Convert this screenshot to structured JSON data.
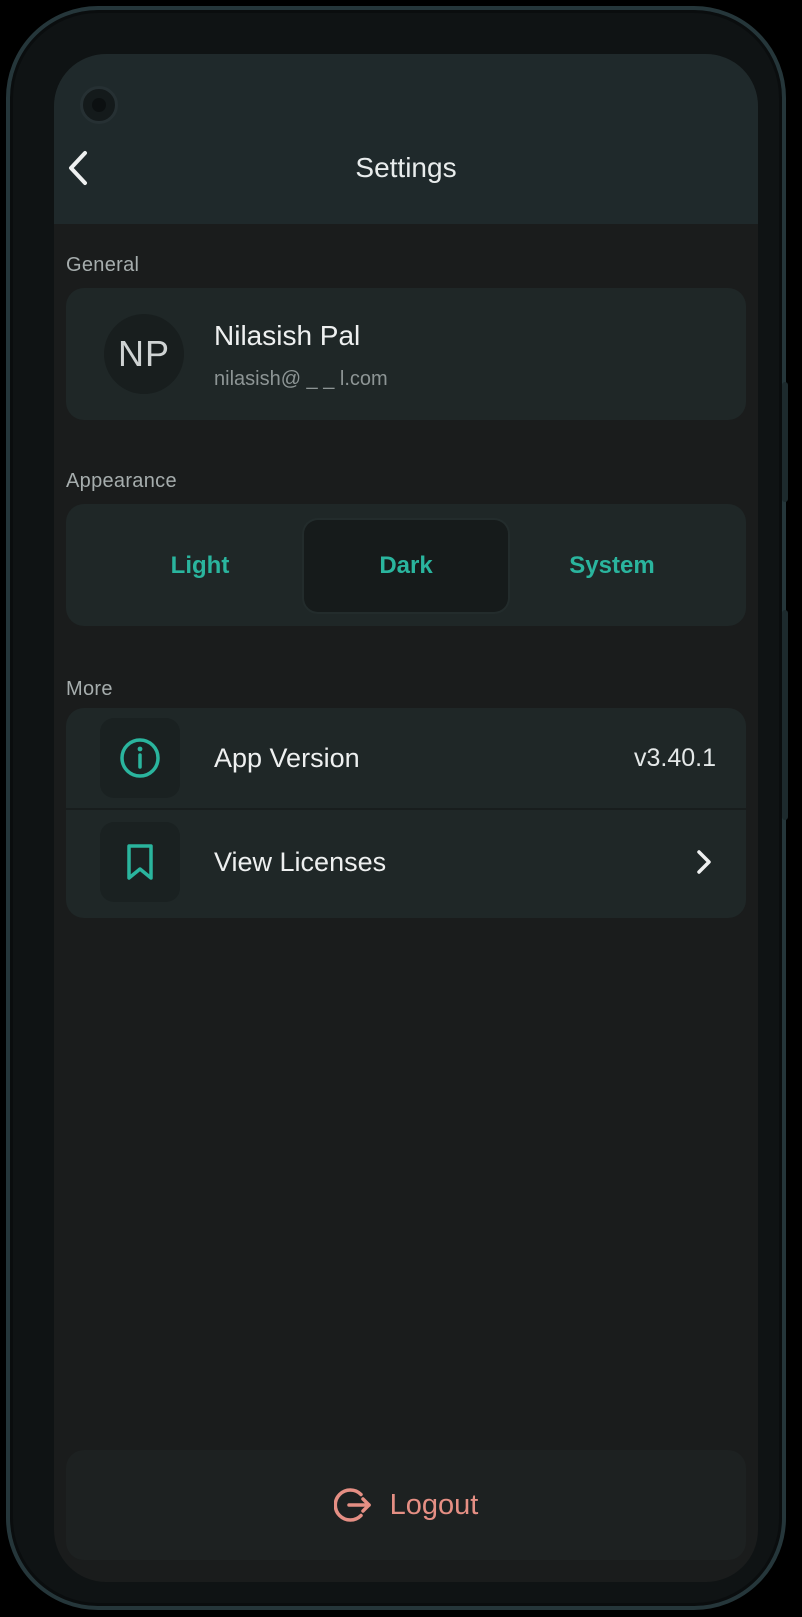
{
  "header": {
    "title": "Settings",
    "back_icon": "chevron-left-icon"
  },
  "general": {
    "section_label": "General",
    "avatar_initials": "NP",
    "user_name": "Nilasish Pal",
    "user_email": "nilasish@ _ _ l.com"
  },
  "appearance": {
    "section_label": "Appearance",
    "options": [
      {
        "label": "Light",
        "selected": false
      },
      {
        "label": "Dark",
        "selected": true
      },
      {
        "label": "System",
        "selected": false
      }
    ]
  },
  "more": {
    "section_label": "More",
    "items": [
      {
        "icon": "info-icon",
        "label": "App Version",
        "value": "v3.40.1"
      },
      {
        "icon": "bookmark-icon",
        "label": "View Licenses",
        "trailing_icon": "chevron-right-icon"
      }
    ]
  },
  "footer": {
    "logout_label": "Logout",
    "logout_icon": "logout-icon"
  },
  "colors": {
    "accent": "#2ab59e",
    "logout": "#e58f84",
    "background": "#1a1c1c",
    "card": "#1f2727"
  }
}
